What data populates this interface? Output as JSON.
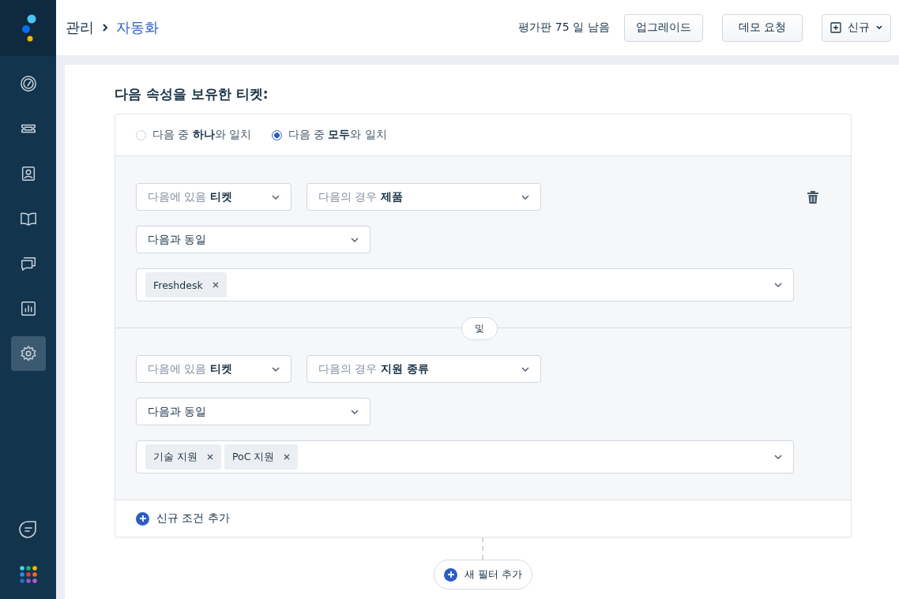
{
  "sidebar": {
    "items": [
      {
        "kind": "gauge",
        "selected": false
      },
      {
        "kind": "ticket",
        "selected": false
      },
      {
        "kind": "contact",
        "selected": false
      },
      {
        "kind": "book",
        "selected": false
      },
      {
        "kind": "chat",
        "selected": false
      },
      {
        "kind": "report",
        "selected": false
      },
      {
        "kind": "gear",
        "selected": true
      }
    ]
  },
  "breadcrumb": [
    "관리",
    "자동화"
  ],
  "header": {
    "trial": "평가판 75 일 남음",
    "buttons": [
      {
        "kind": "plain",
        "label": "업그레이드"
      },
      {
        "kind": "plain",
        "label": "데모 요청"
      },
      {
        "kind": "new",
        "label": "신규"
      }
    ]
  },
  "section_title": "다음 속성을 보유한 티켓:",
  "match_options": [
    {
      "label": "다음 중 **하나**와 일치",
      "selected": false
    },
    {
      "label": "다음 중 **모두**와 일치",
      "selected": true
    }
  ],
  "conditions": [
    {
      "source": {
        "prefix": "다음에 있음",
        "value": "티켓"
      },
      "field": {
        "prefix": "다음의 경우",
        "value": "제품"
      },
      "operator": "다음과 동일",
      "tags": [
        "Freshdesk"
      ],
      "deletable": true
    },
    {
      "source": {
        "prefix": "다음에 있음",
        "value": "티켓"
      },
      "field": {
        "prefix": "다음의 경우",
        "value": "지원 종류"
      },
      "operator": "다음과 동일",
      "tags": [
        "기술 지원",
        "PoC 지원"
      ],
      "deletable": false
    }
  ],
  "joiner": "및",
  "add_condition": "신규 조건 추가",
  "add_filter": "새 필터 추가"
}
